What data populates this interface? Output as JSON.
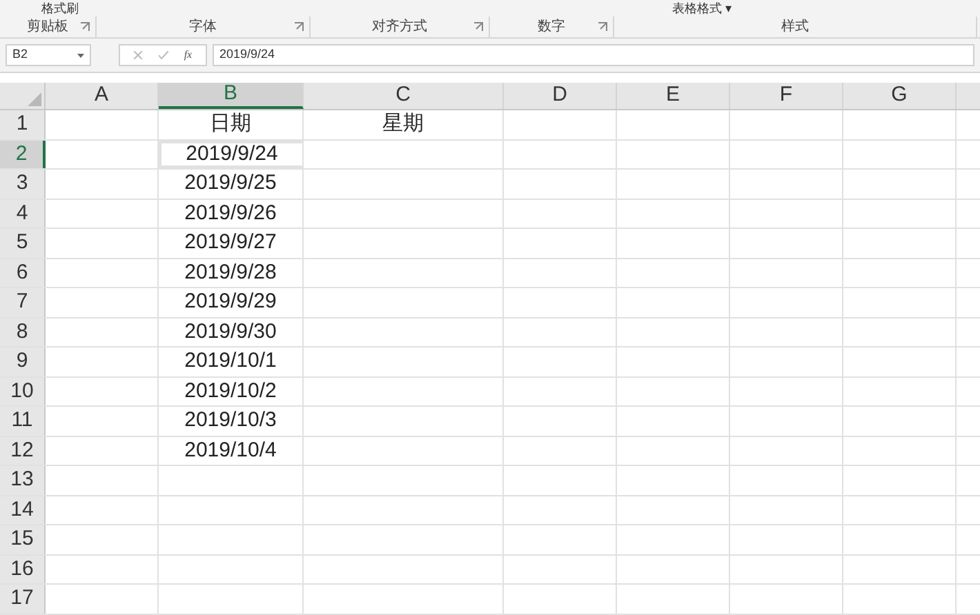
{
  "ribbon": {
    "top_items": [
      {
        "label": "格式刷"
      },
      {
        "label": "表格格式 ▾"
      }
    ],
    "groups": [
      {
        "label": "剪贴板",
        "launcher": true
      },
      {
        "label": "字体",
        "launcher": true
      },
      {
        "label": "对齐方式",
        "launcher": true
      },
      {
        "label": "数字",
        "launcher": true
      },
      {
        "label": "样式",
        "launcher": false
      }
    ]
  },
  "formula_bar": {
    "name_box": "B2",
    "fx": "fx",
    "value": "2019/9/24"
  },
  "columns": [
    {
      "label": "A",
      "selected": false
    },
    {
      "label": "B",
      "selected": true
    },
    {
      "label": "C",
      "selected": false
    },
    {
      "label": "D",
      "selected": false
    },
    {
      "label": "E",
      "selected": false
    },
    {
      "label": "F",
      "selected": false
    },
    {
      "label": "G",
      "selected": false
    }
  ],
  "rows": [
    {
      "label": "1",
      "selected": false,
      "cell_b": "日期",
      "cell_c": "星期"
    },
    {
      "label": "2",
      "selected": true,
      "cell_b": "2019/9/24"
    },
    {
      "label": "3",
      "selected": false,
      "cell_b": "2019/9/25"
    },
    {
      "label": "4",
      "selected": false,
      "cell_b": "2019/9/26"
    },
    {
      "label": "5",
      "selected": false,
      "cell_b": "2019/9/27"
    },
    {
      "label": "6",
      "selected": false,
      "cell_b": "2019/9/28"
    },
    {
      "label": "7",
      "selected": false,
      "cell_b": "2019/9/29"
    },
    {
      "label": "8",
      "selected": false,
      "cell_b": "2019/9/30"
    },
    {
      "label": "9",
      "selected": false,
      "cell_b": "2019/10/1"
    },
    {
      "label": "10",
      "selected": false,
      "cell_b": "2019/10/2"
    },
    {
      "label": "11",
      "selected": false,
      "cell_b": "2019/10/3"
    },
    {
      "label": "12",
      "selected": false,
      "cell_b": "2019/10/4"
    },
    {
      "label": "13",
      "selected": false
    },
    {
      "label": "14",
      "selected": false
    },
    {
      "label": "15",
      "selected": false
    },
    {
      "label": "16",
      "selected": false
    },
    {
      "label": "17",
      "selected": false
    }
  ]
}
